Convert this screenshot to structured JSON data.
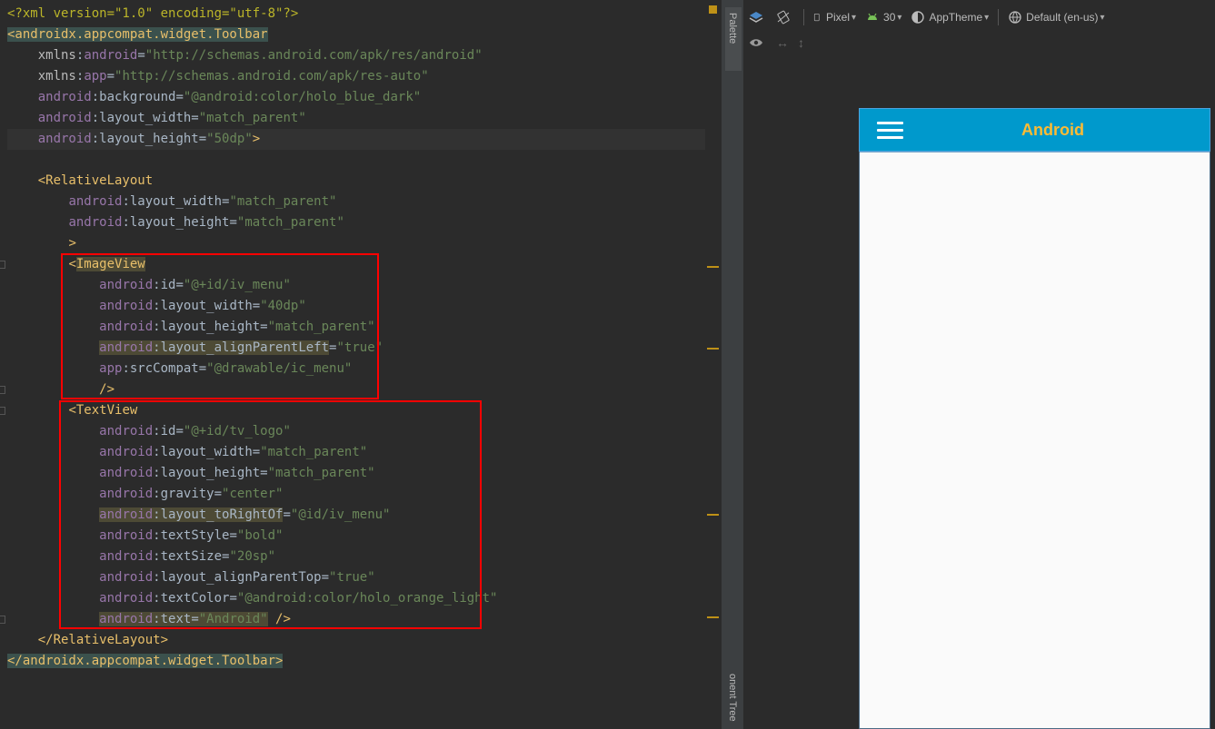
{
  "editor": {
    "lines": [
      [
        {
          "t": "<?xml version=\"1.0\" encoding=\"utf-8\"?>",
          "c": "xmldecl"
        }
      ],
      [
        {
          "t": "<androidx.appcompat.widget.Toolbar",
          "c": "tag tag-hl"
        }
      ],
      [
        {
          "t": "    "
        },
        {
          "t": "xmlns",
          "c": "attr"
        },
        {
          "t": ":"
        },
        {
          "t": "android",
          "c": "ns"
        },
        {
          "t": "="
        },
        {
          "t": "\"http://schemas.android.com/apk/res/android\"",
          "c": "val"
        }
      ],
      [
        {
          "t": "    "
        },
        {
          "t": "xmlns",
          "c": "attr"
        },
        {
          "t": ":"
        },
        {
          "t": "app",
          "c": "ns"
        },
        {
          "t": "="
        },
        {
          "t": "\"http://schemas.android.com/apk/res-auto\"",
          "c": "val"
        }
      ],
      [
        {
          "t": "    "
        },
        {
          "t": "android",
          "c": "ns"
        },
        {
          "t": ":background="
        },
        {
          "t": "\"@android:color/holo_blue_dark\"",
          "c": "val"
        }
      ],
      [
        {
          "t": "    "
        },
        {
          "t": "android",
          "c": "ns"
        },
        {
          "t": ":layout_width="
        },
        {
          "t": "\"match_parent\"",
          "c": "val"
        }
      ],
      [
        {
          "t": "    "
        },
        {
          "t": "android",
          "c": "ns"
        },
        {
          "t": ":layout_height="
        },
        {
          "t": "\"50dp\"",
          "c": "val"
        },
        {
          "t": ">",
          "c": "tag"
        }
      ],
      [
        {
          "t": ""
        }
      ],
      [
        {
          "t": "    "
        },
        {
          "t": "<RelativeLayout",
          "c": "tag"
        }
      ],
      [
        {
          "t": "        "
        },
        {
          "t": "android",
          "c": "ns"
        },
        {
          "t": ":layout_width="
        },
        {
          "t": "\"match_parent\"",
          "c": "val"
        }
      ],
      [
        {
          "t": "        "
        },
        {
          "t": "android",
          "c": "ns"
        },
        {
          "t": ":layout_height="
        },
        {
          "t": "\"match_parent\"",
          "c": "val"
        }
      ],
      [
        {
          "t": "        "
        },
        {
          "t": ">",
          "c": "tag"
        }
      ],
      [
        {
          "t": "        "
        },
        {
          "t": "<",
          "c": "tag"
        },
        {
          "t": "ImageView",
          "c": "tag hl"
        }
      ],
      [
        {
          "t": "            "
        },
        {
          "t": "android",
          "c": "ns"
        },
        {
          "t": ":id="
        },
        {
          "t": "\"@+id/iv_menu\"",
          "c": "val"
        }
      ],
      [
        {
          "t": "            "
        },
        {
          "t": "android",
          "c": "ns"
        },
        {
          "t": ":layout_width="
        },
        {
          "t": "\"40dp\"",
          "c": "val"
        }
      ],
      [
        {
          "t": "            "
        },
        {
          "t": "android",
          "c": "ns"
        },
        {
          "t": ":layout_height="
        },
        {
          "t": "\"match_parent\"",
          "c": "val"
        }
      ],
      [
        {
          "t": "            "
        },
        {
          "t": "android",
          "c": "ns hl"
        },
        {
          "t": ":layout_alignParentLeft",
          "c": "hl"
        },
        {
          "t": "="
        },
        {
          "t": "\"true\"",
          "c": "val"
        }
      ],
      [
        {
          "t": "            "
        },
        {
          "t": "app",
          "c": "ns"
        },
        {
          "t": ":srcCompat="
        },
        {
          "t": "\"@drawable/ic_menu\"",
          "c": "val"
        }
      ],
      [
        {
          "t": "            "
        },
        {
          "t": "/>",
          "c": "tag"
        }
      ],
      [
        {
          "t": "        "
        },
        {
          "t": "<TextView",
          "c": "tag"
        }
      ],
      [
        {
          "t": "            "
        },
        {
          "t": "android",
          "c": "ns"
        },
        {
          "t": ":id="
        },
        {
          "t": "\"@+id/tv_logo\"",
          "c": "val"
        }
      ],
      [
        {
          "t": "            "
        },
        {
          "t": "android",
          "c": "ns"
        },
        {
          "t": ":layout_width="
        },
        {
          "t": "\"match_parent\"",
          "c": "val"
        }
      ],
      [
        {
          "t": "            "
        },
        {
          "t": "android",
          "c": "ns"
        },
        {
          "t": ":layout_height="
        },
        {
          "t": "\"match_parent\"",
          "c": "val"
        }
      ],
      [
        {
          "t": "            "
        },
        {
          "t": "android",
          "c": "ns"
        },
        {
          "t": ":gravity="
        },
        {
          "t": "\"center\"",
          "c": "val"
        }
      ],
      [
        {
          "t": "            "
        },
        {
          "t": "android",
          "c": "ns hl"
        },
        {
          "t": ":layout_toRightOf",
          "c": "hl"
        },
        {
          "t": "="
        },
        {
          "t": "\"@id/iv_menu\"",
          "c": "val"
        }
      ],
      [
        {
          "t": "            "
        },
        {
          "t": "android",
          "c": "ns"
        },
        {
          "t": ":textStyle="
        },
        {
          "t": "\"bold\"",
          "c": "val"
        }
      ],
      [
        {
          "t": "            "
        },
        {
          "t": "android",
          "c": "ns"
        },
        {
          "t": ":textSize="
        },
        {
          "t": "\"20sp\"",
          "c": "val"
        }
      ],
      [
        {
          "t": "            "
        },
        {
          "t": "android",
          "c": "ns"
        },
        {
          "t": ":layout_alignParentTop="
        },
        {
          "t": "\"true\"",
          "c": "val"
        }
      ],
      [
        {
          "t": "            "
        },
        {
          "t": "android",
          "c": "ns"
        },
        {
          "t": ":textColor="
        },
        {
          "t": "\"@android:color/holo_orange_light\"",
          "c": "val"
        }
      ],
      [
        {
          "t": "            "
        },
        {
          "t": "android",
          "c": "ns hl"
        },
        {
          "t": ":text=",
          "c": "hl"
        },
        {
          "t": "\"Android\"",
          "c": "val hl"
        },
        {
          "t": " "
        },
        {
          "t": "/>",
          "c": "tag"
        }
      ],
      [
        {
          "t": "    "
        },
        {
          "t": "</RelativeLayout>",
          "c": "tag"
        }
      ],
      [
        {
          "t": "</androidx.appcompat.widget.Toolbar>",
          "c": "tag tag-hl"
        }
      ]
    ]
  },
  "side": {
    "palette_label": "Palette",
    "component_tree_label": "onent Tree"
  },
  "toolbar": {
    "device": "Pixel",
    "api": "30",
    "theme": "AppTheme",
    "locale": "Default (en-us)"
  },
  "preview": {
    "title": "Android",
    "toolbar_color": "#0099cc",
    "title_color": "#ffbb33"
  }
}
